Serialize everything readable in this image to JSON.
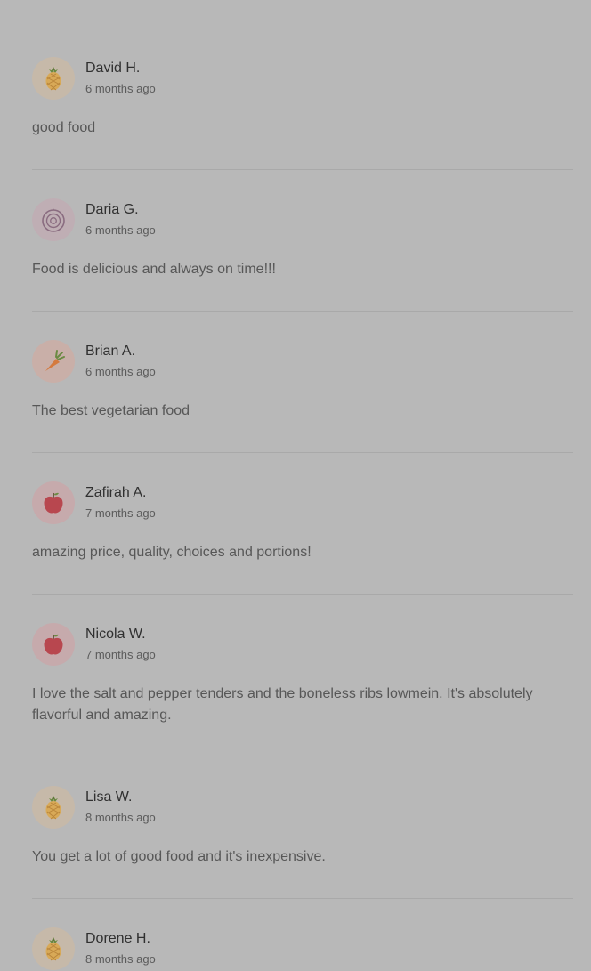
{
  "reviews": [
    {
      "name": "David H.",
      "time": "6 months ago",
      "text": "good food",
      "avatar": "pineapple-icon"
    },
    {
      "name": "Daria G.",
      "time": "6 months ago",
      "text": "Food is delicious and always on time!!!",
      "avatar": "onion-icon"
    },
    {
      "name": "Brian A.",
      "time": "6 months ago",
      "text": "The best vegetarian food",
      "avatar": "carrot-icon"
    },
    {
      "name": "Zafirah A.",
      "time": "7 months ago",
      "text": "amazing price, quality, choices and portions!",
      "avatar": "apple-icon"
    },
    {
      "name": "Nicola W.",
      "time": "7 months ago",
      "text": "I love the salt and pepper tenders and the boneless ribs lowmein. It's absolutely flavorful and amazing.",
      "avatar": "apple-icon"
    },
    {
      "name": "Lisa W.",
      "time": "8 months ago",
      "text": "You get a lot of good food and it's inexpensive.",
      "avatar": "pineapple-icon"
    },
    {
      "name": "Dorene H.",
      "time": "8 months ago",
      "text": "",
      "avatar": "pineapple-icon"
    }
  ],
  "colors": {
    "overlay_background": "#b8b8b8",
    "divider": "#a9a9a9",
    "name_text": "#303030",
    "body_text": "#575757"
  }
}
